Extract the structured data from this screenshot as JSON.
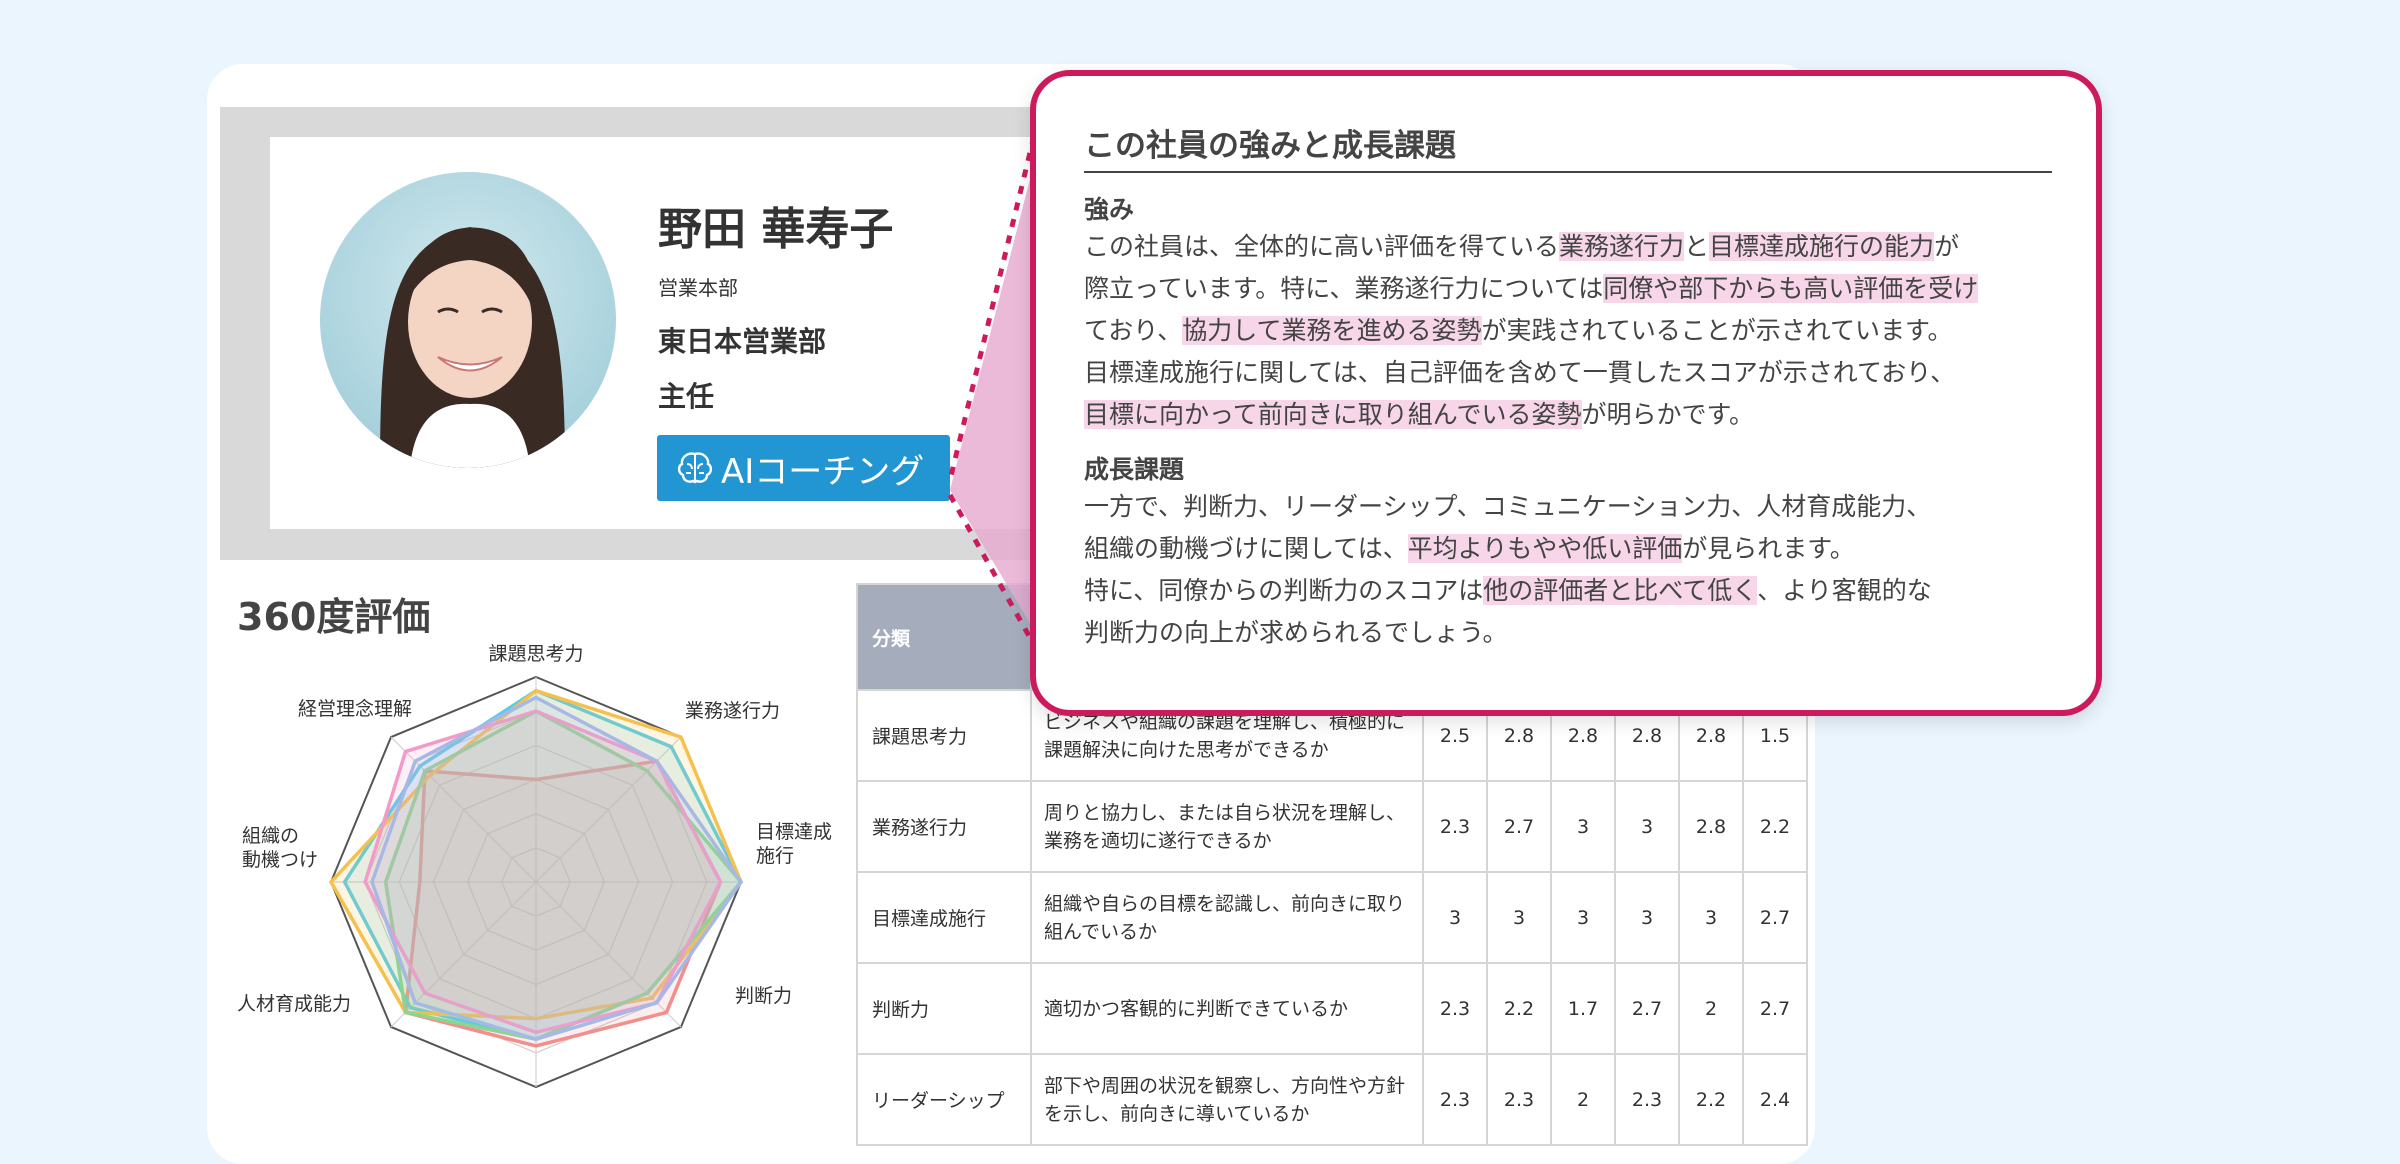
{
  "profile": {
    "name": "野田 華寿子",
    "division": "営業本部",
    "department": "東日本営業部",
    "position": "主任",
    "ai_button_label": "AIコーチング"
  },
  "evaluation": {
    "title": "360度評価",
    "radar": {
      "axes": [
        "課題思考力",
        "業務遂行力",
        "目標達成施行",
        "判断力",
        "リーダーシップ",
        "人材育成能力",
        "組織の動機つけ",
        "経営理念理解"
      ],
      "axis_labels": {
        "kadai": "課題思考力",
        "gyomu": "業務遂行力",
        "mokuhyo_1": "目標達成",
        "mokuhyo_2": "施行",
        "handan": "判断力",
        "jinzai": "人材育成能力",
        "soshiki_1": "組織の",
        "soshiki_2": "動機つけ",
        "keiei": "経営理念理解"
      },
      "max": 3,
      "series_colors": [
        "#f28e8e",
        "#58cde6",
        "#f6c04f",
        "#8fd48e",
        "#f49ac8",
        "#a7b8e6"
      ],
      "series": [
        {
          "values": [
            1.5,
            2.5,
            2.7,
            2.7,
            2.4,
            2.7,
            1.7,
            2.3
          ]
        },
        {
          "values": [
            2.8,
            2.8,
            3.0,
            2.3,
            2.3,
            2.6,
            2.8,
            2.4
          ]
        },
        {
          "values": [
            2.8,
            3.0,
            3.0,
            2.4,
            2.0,
            2.7,
            3.0,
            2.2
          ]
        },
        {
          "values": [
            2.5,
            2.3,
            3.0,
            2.3,
            2.3,
            2.7,
            2.2,
            2.3
          ]
        },
        {
          "values": [
            2.5,
            2.5,
            2.7,
            2.5,
            2.2,
            2.3,
            2.5,
            2.7
          ]
        },
        {
          "values": [
            2.7,
            2.5,
            3.0,
            2.5,
            2.3,
            2.5,
            2.4,
            2.5
          ]
        }
      ]
    },
    "table": {
      "header_category": "分類",
      "rows": [
        {
          "category": "課題思考力",
          "description": "ビジネスや組織の課題を理解し、積極的に課題解決に向けた思考ができるか",
          "scores": [
            "2.5",
            "2.8",
            "2.8",
            "2.8",
            "2.8",
            "1.5"
          ]
        },
        {
          "category": "業務遂行力",
          "description": "周りと協力し、または自ら状況を理解し、業務を適切に遂行できるか",
          "scores": [
            "2.3",
            "2.7",
            "3",
            "3",
            "2.8",
            "2.2"
          ]
        },
        {
          "category": "目標達成施行",
          "description": "組織や自らの目標を認識し、前向きに取り組んでいるか",
          "scores": [
            "3",
            "3",
            "3",
            "3",
            "3",
            "2.7"
          ]
        },
        {
          "category": "判断力",
          "description": "適切かつ客観的に判断できているか",
          "scores": [
            "2.3",
            "2.2",
            "1.7",
            "2.7",
            "2",
            "2.7"
          ]
        },
        {
          "category": "リーダーシップ",
          "description": "部下や周囲の状況を観察し、方向性や方針を示し、前向きに導いているか",
          "scores": [
            "2.3",
            "2.3",
            "2",
            "2.3",
            "2.2",
            "2.4"
          ]
        }
      ]
    }
  },
  "coaching": {
    "title": "この社員の強みと成長課題",
    "strength_heading": "強み",
    "strength_lines": [
      [
        "この社員は、全体的に高い評価を得ている",
        "業務遂行力",
        "と",
        "目標達成施行の能力",
        "が"
      ],
      [
        "際立っています。特に、業務遂行力については",
        "同僚や部下からも高い評価を受け",
        "",
        "",
        ""
      ],
      [
        "ており、",
        "協力して業務を進める姿勢",
        "が実践されていることが示されています。",
        "",
        ""
      ],
      [
        "目標達成施行に関しては、自己評価を含めて一貫したスコアが示されており、",
        "",
        "",
        "",
        ""
      ],
      [
        "",
        "目標に向かって前向きに取り組んでいる姿勢",
        "が明らかです。",
        "",
        ""
      ]
    ],
    "growth_heading": "成長課題",
    "growth_lines": [
      [
        "一方で、判断力、リーダーシップ、コミュニケーション力、人材育成能力、",
        "",
        ""
      ],
      [
        "組織の動機づけに関しては、",
        "平均よりもやや低い評価",
        "が見られます。"
      ],
      [
        "特に、同僚からの判断力のスコアは",
        "他の評価者と比べて低く",
        "、より客観的な"
      ],
      [
        "判断力の向上が求められるでしょう。",
        "",
        ""
      ]
    ]
  }
}
